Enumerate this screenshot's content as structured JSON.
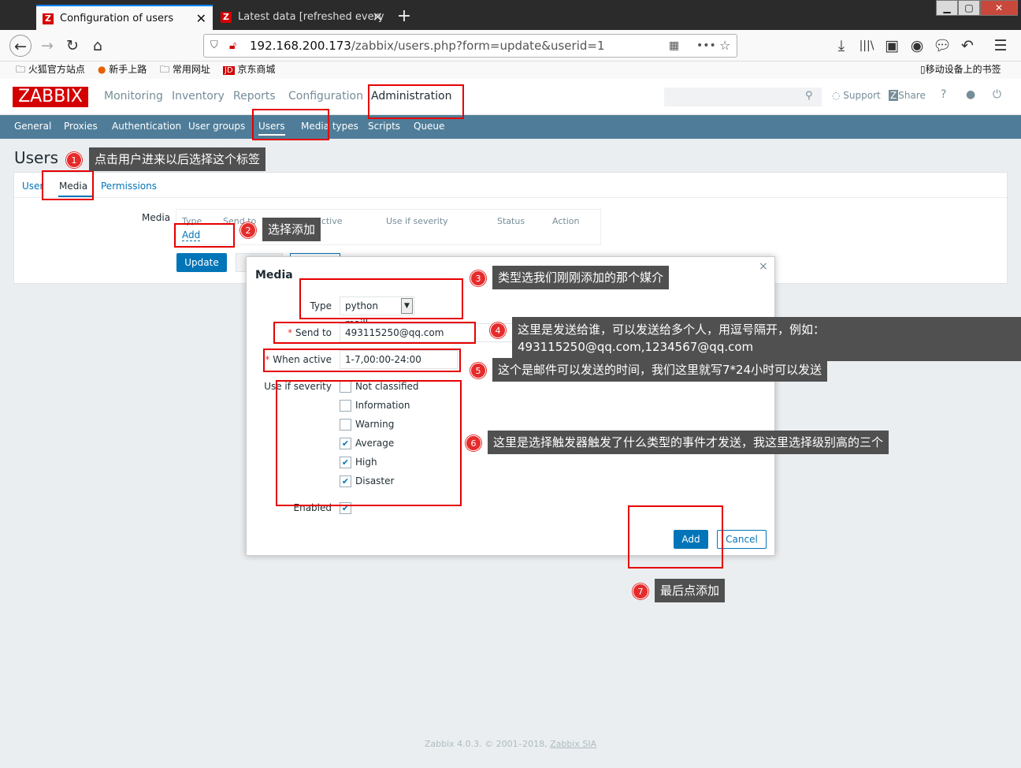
{
  "browser": {
    "tabs": [
      {
        "label": "Configuration of users",
        "icon": "zabbix-icon"
      },
      {
        "label": "Latest data [refreshed every",
        "icon": "zabbix-icon"
      }
    ],
    "url_host": "192.168.200.173",
    "url_path": "/zabbix/users.php?form=update&userid=1",
    "bookmarks": [
      "火狐官方站点",
      "新手上路",
      "常用网址",
      "京东商城"
    ],
    "mobile_bookmarks": "移动设备上的书签"
  },
  "zabbix": {
    "logo": "ZABBIX",
    "top_menu": [
      "Monitoring",
      "Inventory",
      "Reports",
      "Configuration",
      "Administration"
    ],
    "support": "Support",
    "share": "Share",
    "help": "?",
    "sub_menu": [
      "General",
      "Proxies",
      "Authentication",
      "User groups",
      "Users",
      "Media types",
      "Scripts",
      "Queue"
    ],
    "page_title": "Users",
    "tabs": [
      "User",
      "Media",
      "Permissions"
    ],
    "media_label": "Media",
    "media_columns": [
      "Type",
      "Send to",
      "When active",
      "Use if severity",
      "Status",
      "Action"
    ],
    "add_link": "Add",
    "update_button": "Update",
    "footer": "Zabbix 4.0.3. © 2001–2018, ",
    "footer_link": "Zabbix SIA"
  },
  "dialog": {
    "title": "Media",
    "close": "×",
    "type_label": "Type",
    "type_value": "python maill",
    "send_to_label": "Send to",
    "send_to_value": "493115250@qq.com",
    "when_active_label": "When active",
    "when_active_value": "1-7,00:00-24:00",
    "severity_label": "Use if severity",
    "severities": [
      {
        "label": "Not classified",
        "checked": false
      },
      {
        "label": "Information",
        "checked": false
      },
      {
        "label": "Warning",
        "checked": false
      },
      {
        "label": "Average",
        "checked": true
      },
      {
        "label": "High",
        "checked": true
      },
      {
        "label": "Disaster",
        "checked": true
      }
    ],
    "enabled_label": "Enabled",
    "add_button": "Add",
    "cancel_button": "Cancel"
  },
  "annotations": [
    {
      "n": "1",
      "text": "点击用户进来以后选择这个标签"
    },
    {
      "n": "2",
      "text": "选择添加"
    },
    {
      "n": "3",
      "text": "类型选我们刚刚添加的那个媒介"
    },
    {
      "n": "4",
      "text": "这里是发送给谁，可以发送给多个人，用逗号隔开，例如：",
      "text2": "493115250@qq.com,1234567@qq.com"
    },
    {
      "n": "5",
      "text": "这个是邮件可以发送的时间，我们这里就写7*24小时可以发送"
    },
    {
      "n": "6",
      "text": "这里是选择触发器触发了什么类型的事件才发送，我这里选择级别高的三个"
    },
    {
      "n": "7",
      "text": "最后点添加"
    }
  ],
  "colors": {
    "brand": "#d40000",
    "accent": "#0275b8",
    "submenu_bg": "#4f7d99",
    "annotation": "#e60000"
  }
}
